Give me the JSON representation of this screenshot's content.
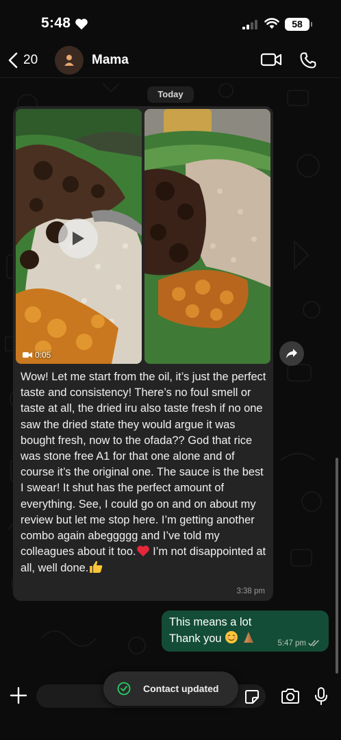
{
  "status_bar": {
    "time": "5:48",
    "battery": "58"
  },
  "header": {
    "back_count": "20",
    "contact_name": "Mama"
  },
  "chat": {
    "date_label": "Today",
    "incoming": {
      "video_duration": "0:05",
      "text": "Wow! Let me start from the oil, it’s just the perfect taste and consistency! There’s no foul smell or taste at all, the dried iru also taste fresh if no one saw the dried state they would argue it was bought fresh, now to the ofada?? God that rice was stone free A1 for that one alone and of course it’s the original one. The sauce is the best I swear! It shut has the perfect amount of everything. See, I could go on and on about my review but let me stop here.  I’m getting another combo again abeggggg and I’ve told my colleagues about it too.",
      "text_tail_1": " I’m not disappointed at all, well done.",
      "time": "3:38 pm"
    },
    "outgoing": {
      "line1": "This means a lot",
      "line2": "Thank you",
      "time": "5:47 pm"
    }
  },
  "input_bar": {
    "placeholder": ""
  },
  "toast": {
    "text": "Contact updated"
  },
  "colors": {
    "incoming_bubble": "#242424",
    "outgoing_bubble": "#144d37",
    "accent_green": "#25d366"
  },
  "icons": {
    "back": "chevron-left-icon",
    "video": "video-camera-icon",
    "phone": "phone-icon",
    "play": "play-icon",
    "forward": "forward-icon",
    "plus": "plus-icon",
    "sticker": "sticker-icon",
    "camera": "camera-icon",
    "mic": "microphone-icon",
    "check": "check-circle-icon"
  }
}
